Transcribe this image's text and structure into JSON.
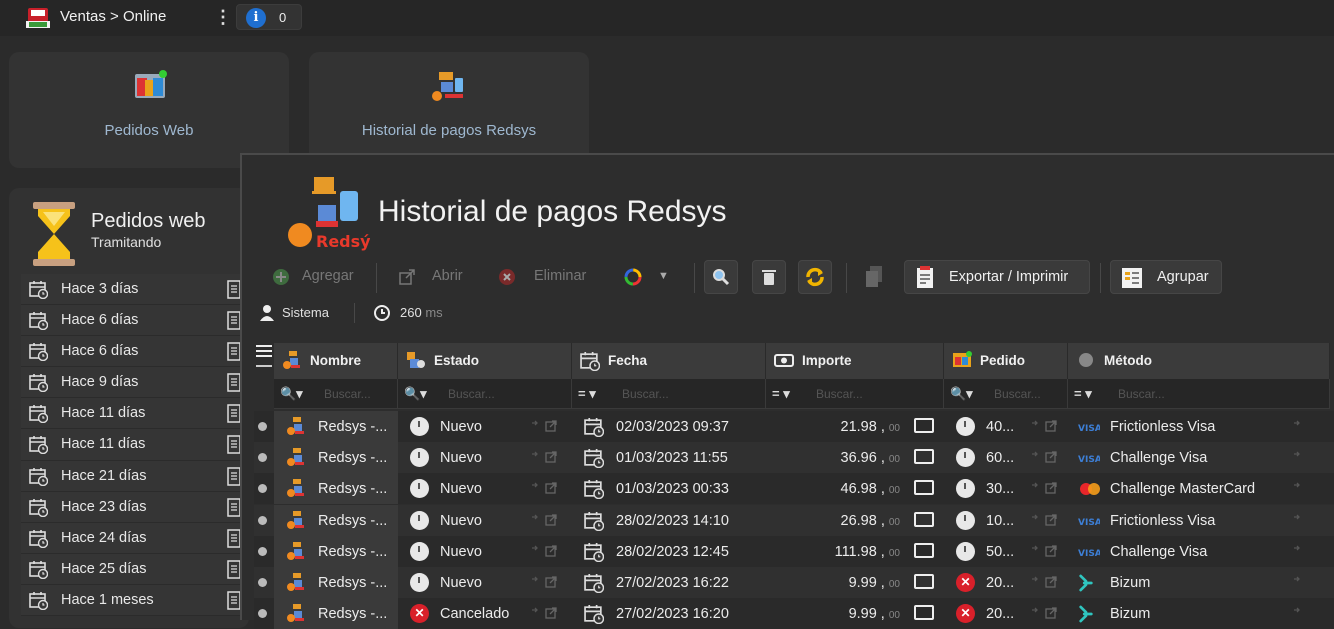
{
  "topbar": {
    "breadcrumb": "Ventas > Online",
    "info_count": "0",
    "app_icon_text": "VENTAS ONLINE"
  },
  "tiles": [
    {
      "label": "Pedidos Web"
    },
    {
      "label": "Historial de pagos Redsys"
    }
  ],
  "left_panel": {
    "title": "Pedidos web",
    "subtitle": "Tramitando",
    "items": [
      "Hace 3 días",
      "Hace 6 días",
      "Hace 6 días",
      "Hace 9 días",
      "Hace 11 días",
      "Hace 11 días",
      "Hace 21 días",
      "Hace 23 días",
      "Hace 24 días",
      "Hace 25 días",
      "Hace 1 meses"
    ]
  },
  "window": {
    "title": "Historial de pagos Redsys",
    "logo_text": "Redsýs",
    "toolbar": {
      "add": "Agregar",
      "open": "Abrir",
      "delete": "Eliminar",
      "export": "Exportar / Imprimir",
      "group": "Agrupar"
    },
    "status": {
      "user": "Sistema",
      "time_value": "260",
      "time_unit": "ms"
    },
    "columns": [
      {
        "label": "Nombre",
        "filter_op": "🔍▾",
        "placeholder": "Buscar..."
      },
      {
        "label": "Estado",
        "filter_op": "🔍▾",
        "placeholder": "Buscar..."
      },
      {
        "label": "Fecha",
        "filter_op": "= ▾",
        "placeholder": "Buscar..."
      },
      {
        "label": "Importe",
        "filter_op": "= ▾",
        "placeholder": "Buscar..."
      },
      {
        "label": "Pedido",
        "filter_op": "🔍▾",
        "placeholder": "Buscar..."
      },
      {
        "label": "Método",
        "filter_op": "= ▾",
        "placeholder": "Buscar..."
      }
    ],
    "rows": [
      {
        "nombre": "Redsys -...",
        "estado": "Nuevo",
        "estado_kind": "clock",
        "fecha": "02/03/2023 09:37",
        "importe": "21.98 ,",
        "decimals": "00",
        "pedido": "40...",
        "pedido_kind": "clock",
        "metodo": "Frictionless Visa",
        "metodo_kind": "visa"
      },
      {
        "nombre": "Redsys -...",
        "estado": "Nuevo",
        "estado_kind": "clock",
        "fecha": "01/03/2023 11:55",
        "importe": "36.96 ,",
        "decimals": "00",
        "pedido": "60...",
        "pedido_kind": "clock",
        "metodo": "Challenge Visa",
        "metodo_kind": "visa"
      },
      {
        "nombre": "Redsys -...",
        "estado": "Nuevo",
        "estado_kind": "clock",
        "fecha": "01/03/2023 00:33",
        "importe": "46.98 ,",
        "decimals": "00",
        "pedido": "30...",
        "pedido_kind": "clock",
        "metodo": "Challenge MasterCard",
        "metodo_kind": "mastercard"
      },
      {
        "nombre": "Redsys -...",
        "estado": "Nuevo",
        "estado_kind": "clock",
        "fecha": "28/02/2023 14:10",
        "importe": "26.98 ,",
        "decimals": "00",
        "pedido": "10...",
        "pedido_kind": "clock",
        "metodo": "Frictionless Visa",
        "metodo_kind": "visa"
      },
      {
        "nombre": "Redsys -...",
        "estado": "Nuevo",
        "estado_kind": "clock",
        "fecha": "28/02/2023 12:45",
        "importe": "111.98 ,",
        "decimals": "00",
        "pedido": "50...",
        "pedido_kind": "clock",
        "metodo": "Challenge Visa",
        "metodo_kind": "visa"
      },
      {
        "nombre": "Redsys -...",
        "estado": "Nuevo",
        "estado_kind": "clock",
        "fecha": "27/02/2023 16:22",
        "importe": "9.99 ,",
        "decimals": "00",
        "pedido": "20...",
        "pedido_kind": "cancel",
        "metodo": "Bizum",
        "metodo_kind": "bizum"
      },
      {
        "nombre": "Redsys -...",
        "estado": "Cancelado",
        "estado_kind": "cancel",
        "fecha": "27/02/2023 16:20",
        "importe": "9.99 ,",
        "decimals": "00",
        "pedido": "20...",
        "pedido_kind": "cancel",
        "metodo": "Bizum",
        "metodo_kind": "bizum"
      }
    ]
  },
  "colors": {
    "accent": "#1f6fd0",
    "cancel": "#d9202a",
    "tile_label": "#9fb8d0",
    "refresh": "#f0b400"
  }
}
